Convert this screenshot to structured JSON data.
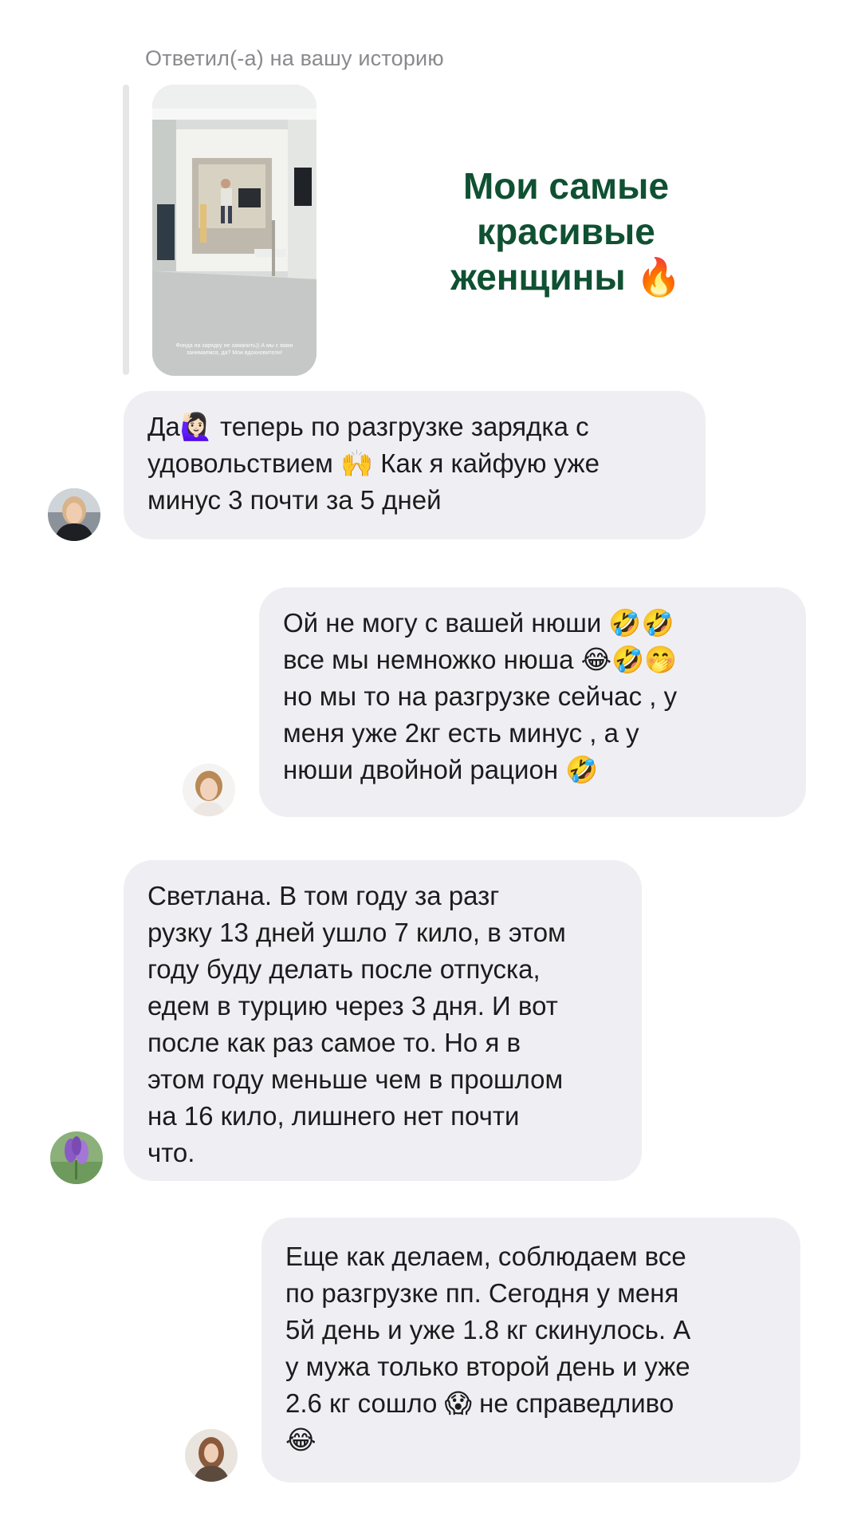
{
  "reply": {
    "label": "Ответил(-а) на вашу историю",
    "story_caption": "Фонда на зарядку не заманить)) А мы с вами занимаемся, да? Мои вдохновители!",
    "story_text": "Мои самые красивые женщины",
    "story_emoji": "🔥"
  },
  "messages": [
    {
      "side": "incoming",
      "text": "Да🙋🏻‍♀️ теперь по разгрузке зарядка с\nудовольствием 🙌 Как я кайфую уже\nминус 3 почти за 5 дней"
    },
    {
      "side": "incoming",
      "text": "Ой не могу с вашей нюши 🤣🤣\nвсе мы немножко нюша 😂🤣🤭\nно мы то на разгрузке сейчас , у\nменя уже 2кг есть минус , а у\nнюши двойной рацион 🤣"
    },
    {
      "side": "incoming",
      "text": "Светлана. В том году за разг\nрузку 13 дней ушло 7 кило, в этом\nгоду буду делать после отпуска,\nедем в турцию через 3 дня. И вот\nпосле как раз самое то. Но я в\nэтом году меньше чем в прошлом\nна 16 кило, лишнего нет почти\nчто."
    },
    {
      "side": "incoming",
      "text": "Еще как делаем, соблюдаем все\nпо разгрузке пп. Сегодня у меня\n5й день и уже 1.8 кг скинулось. А\nу мужа только второй день и уже\n2.6 кг сошло 😱 не справедливо\n😂"
    }
  ],
  "colors": {
    "bubble_bg": "#efeff3",
    "story_text": "#0f5132",
    "label": "#8a8a8e"
  }
}
